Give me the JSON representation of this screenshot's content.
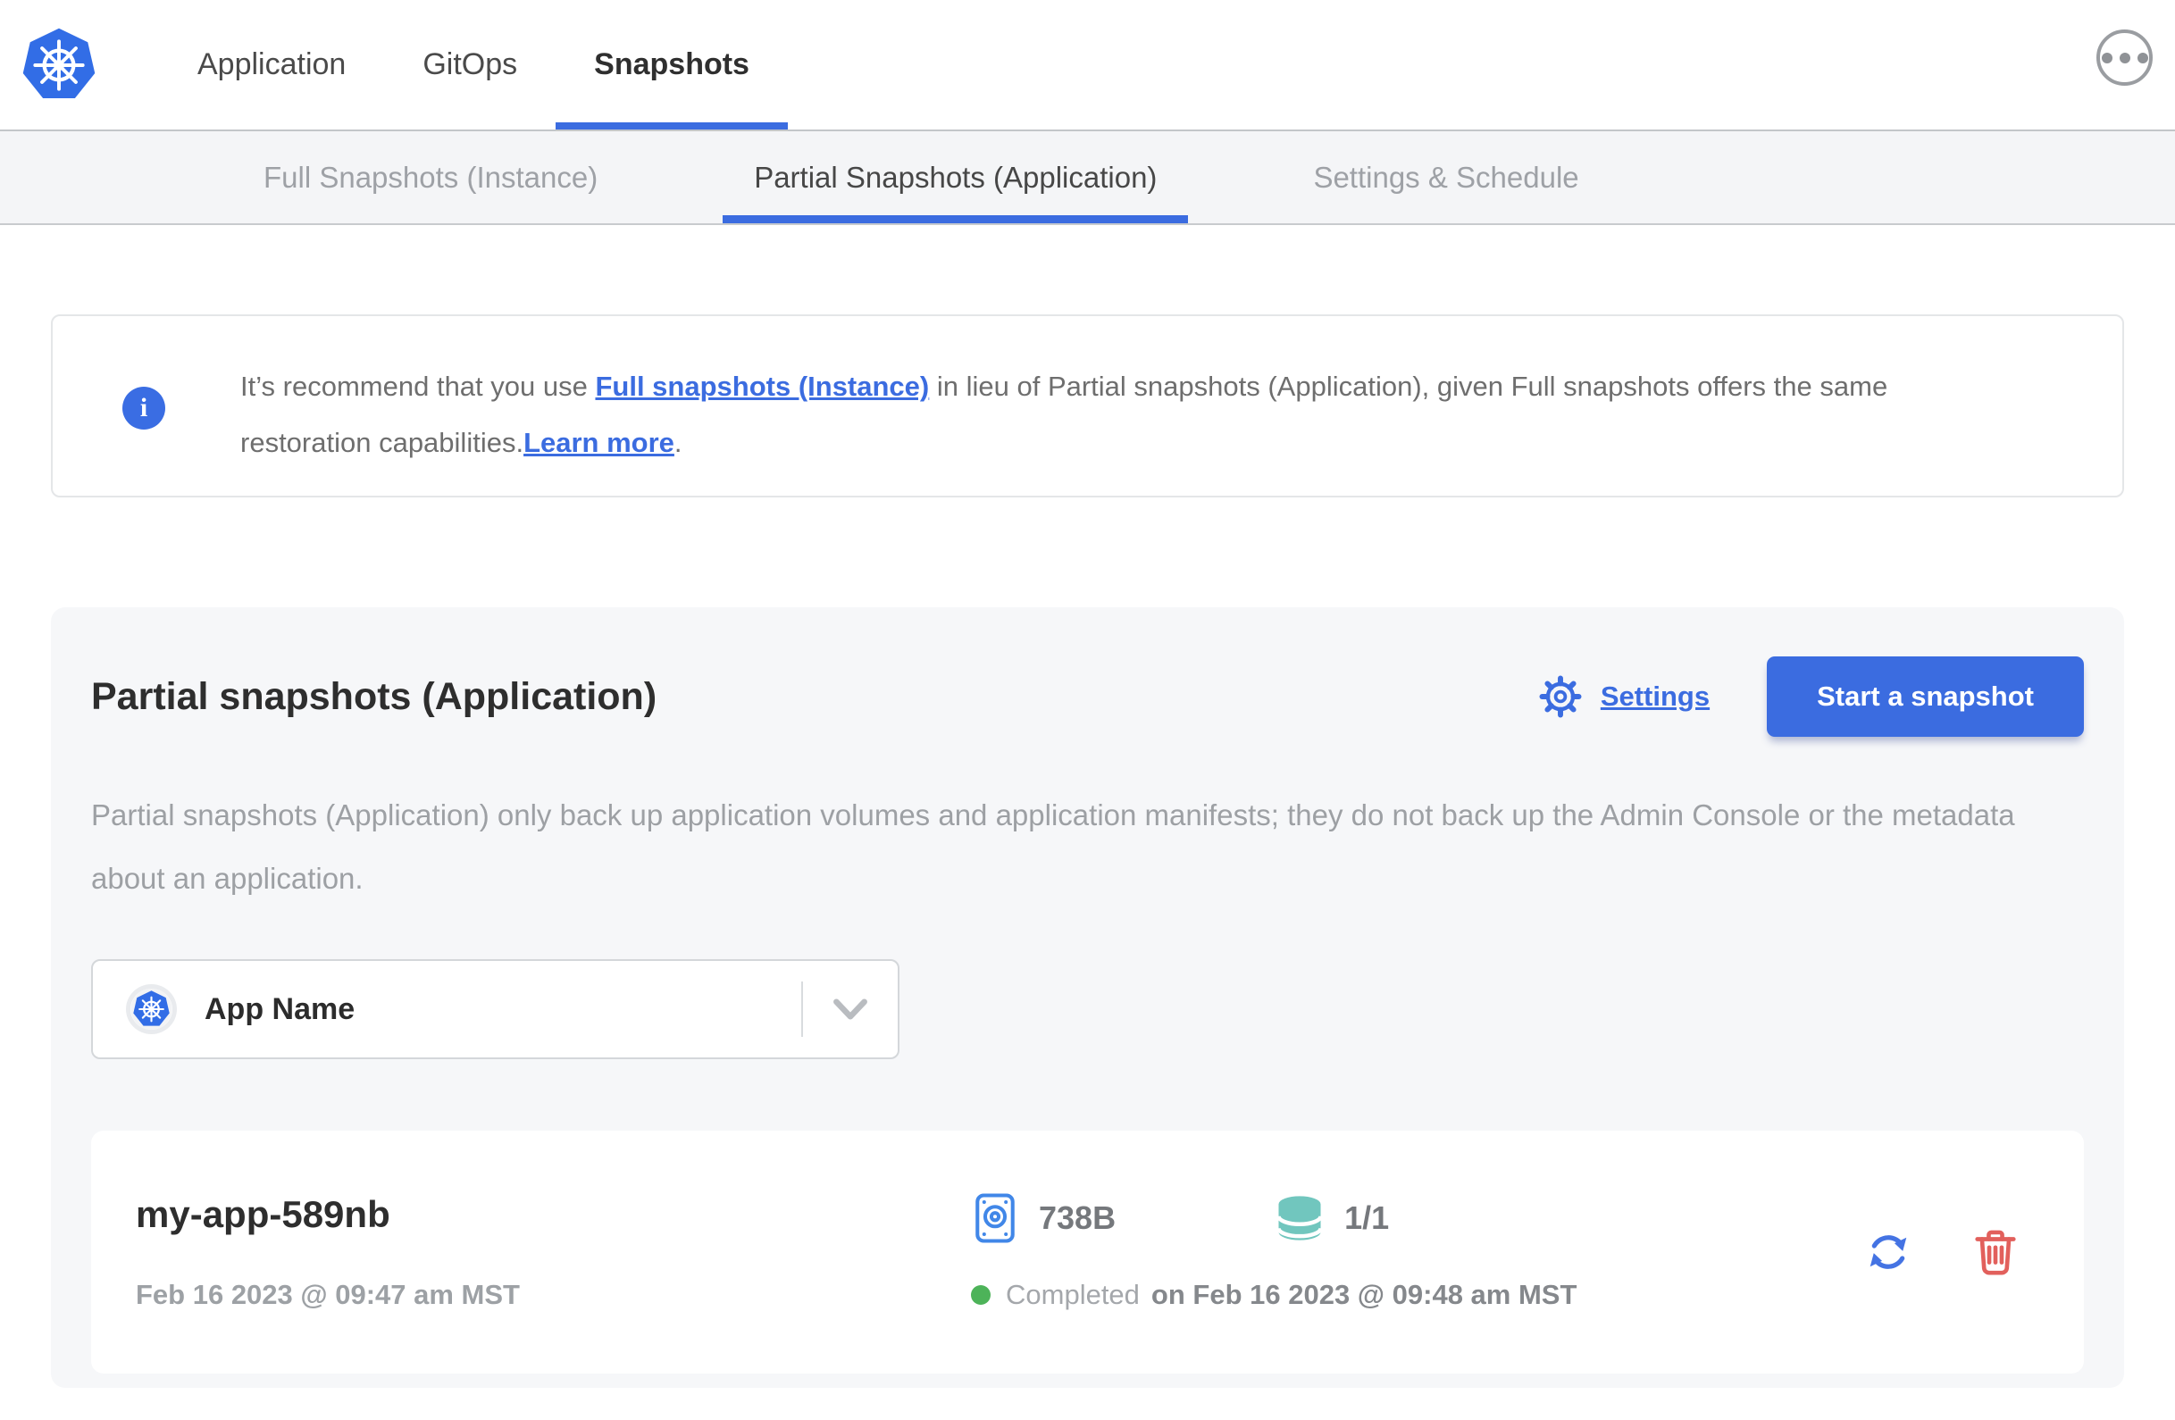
{
  "header": {
    "nav": [
      {
        "label": "Application",
        "active": false
      },
      {
        "label": "GitOps",
        "active": false
      },
      {
        "label": "Snapshots",
        "active": true
      }
    ],
    "info_glyph": "i"
  },
  "subnav": {
    "tabs": [
      {
        "label": "Full Snapshots (Instance)",
        "active": false
      },
      {
        "label": "Partial Snapshots (Application)",
        "active": true
      },
      {
        "label": "Settings & Schedule",
        "active": false
      }
    ]
  },
  "banner": {
    "text_before": "It’s recommend that you use ",
    "link_full_snapshots": "Full snapshots (Instance)",
    "text_middle": " in lieu of Partial snapshots (Application), given Full snapshots offers the same restoration capabilities.",
    "link_learn_more": "Learn more",
    "text_after": "."
  },
  "panel": {
    "title": "Partial snapshots (Application)",
    "settings_label": "Settings",
    "start_button_label": "Start a snapshot",
    "description": "Partial snapshots (Application) only back up application volumes and application manifests; they do not back up the Admin Console or the metadata about an application.",
    "app_selector": {
      "value": "App Name"
    }
  },
  "snapshots": [
    {
      "name": "my-app-589nb",
      "started": "Feb 16 2023 @ 09:47 am MST",
      "size": "738B",
      "volumes": "1/1",
      "status": "Completed",
      "finished": "on Feb 16 2023 @ 09:48 am MST"
    }
  ],
  "colors": {
    "accent_blue": "#3b6ce0",
    "kubernetes_blue": "#326DE6",
    "status_green": "#4db359",
    "volumes_teal": "#71C6BE",
    "disk_blue": "#4187E8",
    "delete_red": "#E2605C"
  }
}
